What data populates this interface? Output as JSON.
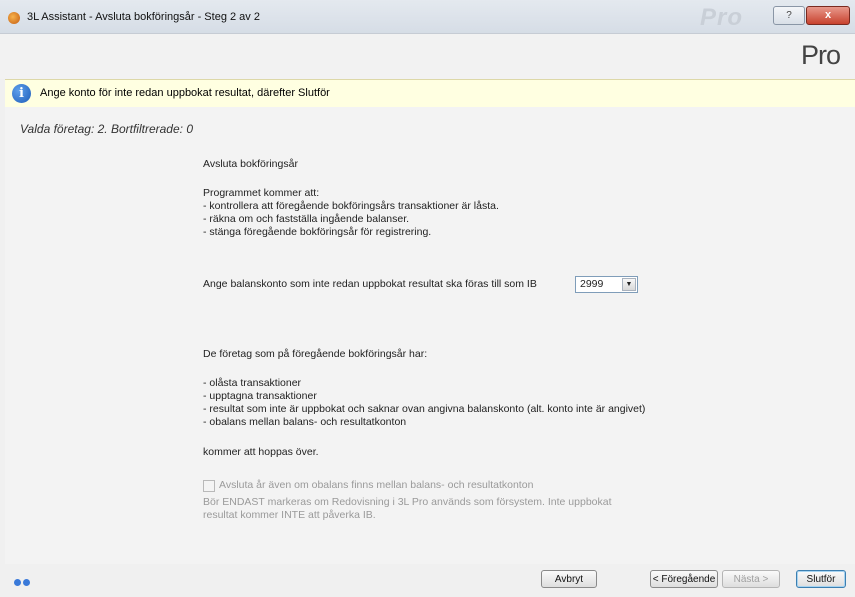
{
  "window": {
    "title": "3L Assistant - Avsluta bokföringsår - Steg 2 av 2",
    "ghost_title": "Pro",
    "help_label": "?",
    "close_label": "x"
  },
  "logo": {
    "text": "Pro"
  },
  "info": {
    "message": "Ange konto för inte redan uppbokat resultat, därefter Slutför"
  },
  "selection": {
    "text": "Valda företag: 2. Bortfiltrerade: 0"
  },
  "main": {
    "heading": "Avsluta bokföringsår",
    "intro": "Programmet kommer att:",
    "steps": [
      " - kontrollera att föregående bokföringsårs transaktioner är låsta.",
      " - räkna om och fastställa ingående balanser.",
      " - stänga föregående bokföringsår för registrering."
    ],
    "account_label": "Ange balanskonto som inte redan uppbokat resultat ska föras till som IB",
    "account_value": "2999",
    "skip_intro": "De företag som på föregående bokföringsår har:",
    "skip_items": [
      "- olåsta transaktioner",
      "- upptagna transaktioner",
      "- resultat som inte är uppbokat och saknar ovan angivna balanskonto (alt. konto inte är angivet)",
      "- obalans mellan balans- och resultatkonton"
    ],
    "skip_outro": "kommer att hoppas över.",
    "checkbox_label": "Avsluta år även om obalans finns mellan balans- och resultatkonton",
    "checkbox_checked": false,
    "note_line1": "Bör ENDAST markeras om Redovisning i 3L Pro används som försystem. Inte uppbokat",
    "note_line2": "resultat kommer INTE att påverka IB."
  },
  "buttons": {
    "cancel": "Avbryt",
    "previous": "< Föregående",
    "next": "Nästa >",
    "finish": "Slutför"
  },
  "colors": {
    "info_bar": "#ffffe1",
    "info_icon": "#1d5cb8",
    "close_button": "#c8422e"
  }
}
